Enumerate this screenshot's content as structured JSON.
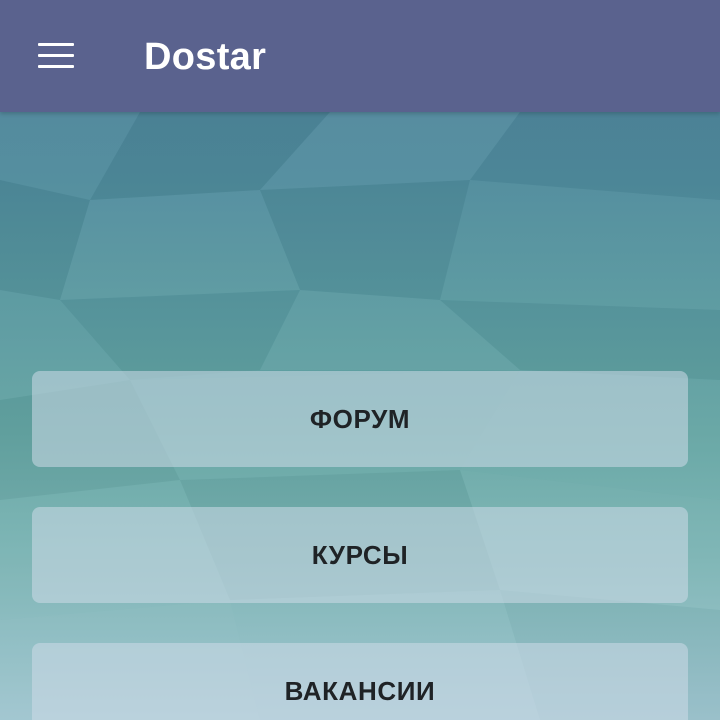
{
  "app_bar": {
    "title": "Dostar",
    "background_color": "#5a628e",
    "menu_icon": "hamburger-menu-icon"
  },
  "background": {
    "style": "low-poly teal-blue gradient"
  },
  "menu_buttons": [
    {
      "label": "ФОРУМ"
    },
    {
      "label": "КУРСЫ"
    },
    {
      "label": "ВАКАНСИИ"
    }
  ]
}
